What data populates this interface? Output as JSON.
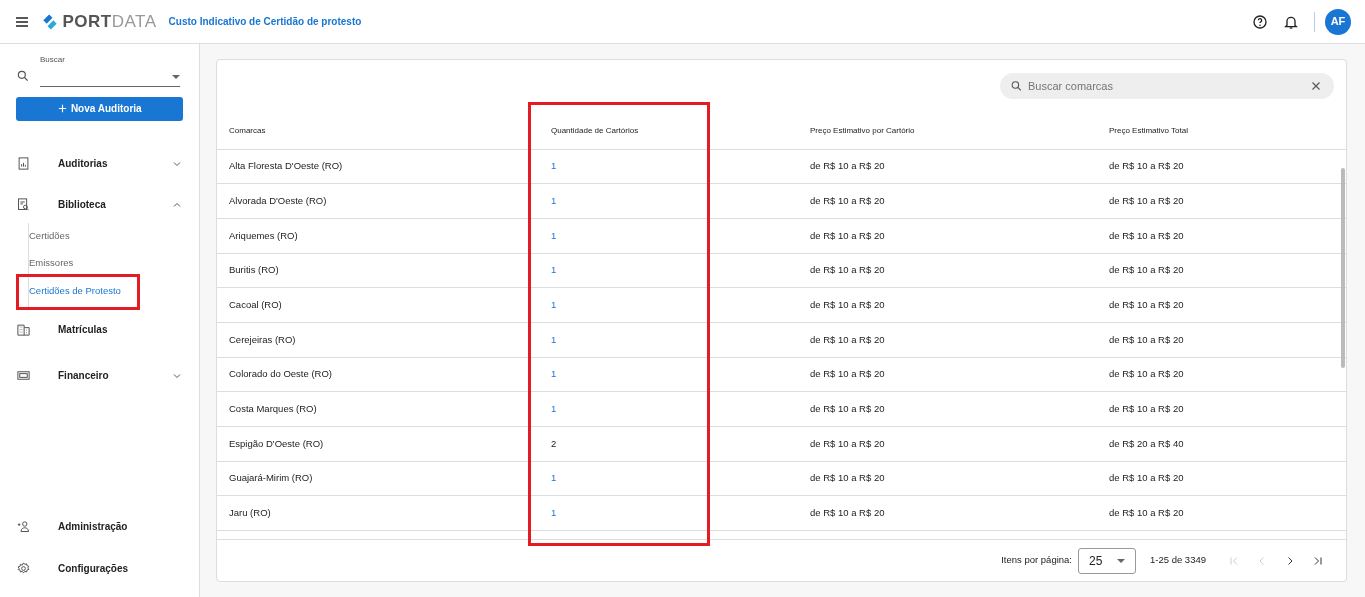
{
  "header": {
    "brand_bold": "PORT",
    "brand_light": "DATA",
    "page_title": "Custo Indicativo de Certidão de protesto",
    "avatar": "AF"
  },
  "sidebar": {
    "search": {
      "label": "Buscar"
    },
    "new_button": "Nova Auditoria",
    "items": [
      {
        "label": "Auditorias",
        "expanded": false
      },
      {
        "label": "Biblioteca",
        "expanded": true,
        "children": [
          {
            "label": "Certidões",
            "selected": false,
            "highlighted": false
          },
          {
            "label": "Emissores",
            "selected": false,
            "highlighted": false
          },
          {
            "label": "Certidões de Protesto",
            "selected": true,
            "highlighted": true
          }
        ]
      },
      {
        "label": "Matrículas"
      },
      {
        "label": "Financeiro",
        "expanded": false
      }
    ],
    "bottom_items": [
      {
        "label": "Administração"
      },
      {
        "label": "Configurações"
      }
    ]
  },
  "search": {
    "placeholder": "Buscar comarcas"
  },
  "table": {
    "columns": [
      {
        "label": "Comarcas",
        "highlighted": false
      },
      {
        "label": "Quantidade de Cartórios",
        "highlighted": true
      },
      {
        "label": "Preço Estimativo por Cartório",
        "highlighted": false
      },
      {
        "label": "Preço Estimativo Total",
        "highlighted": false
      }
    ],
    "rows": [
      {
        "comarca": "Alta Floresta D'Oeste (RO)",
        "quantidade": "1",
        "linked": true,
        "preco": "de R$ 10 a R$ 20",
        "total": "de R$ 10 a R$ 20"
      },
      {
        "comarca": "Alvorada D'Oeste (RO)",
        "quantidade": "1",
        "linked": true,
        "preco": "de R$ 10 a R$ 20",
        "total": "de R$ 10 a R$ 20"
      },
      {
        "comarca": "Ariquemes (RO)",
        "quantidade": "1",
        "linked": true,
        "preco": "de R$ 10 a R$ 20",
        "total": "de R$ 10 a R$ 20"
      },
      {
        "comarca": "Buritis (RO)",
        "quantidade": "1",
        "linked": true,
        "preco": "de R$ 10 a R$ 20",
        "total": "de R$ 10 a R$ 20"
      },
      {
        "comarca": "Cacoal (RO)",
        "quantidade": "1",
        "linked": true,
        "preco": "de R$ 10 a R$ 20",
        "total": "de R$ 10 a R$ 20"
      },
      {
        "comarca": "Cerejeiras (RO)",
        "quantidade": "1",
        "linked": true,
        "preco": "de R$ 10 a R$ 20",
        "total": "de R$ 10 a R$ 20"
      },
      {
        "comarca": "Colorado do Oeste (RO)",
        "quantidade": "1",
        "linked": true,
        "preco": "de R$ 10 a R$ 20",
        "total": "de R$ 10 a R$ 20"
      },
      {
        "comarca": "Costa Marques (RO)",
        "quantidade": "1",
        "linked": true,
        "preco": "de R$ 10 a R$ 20",
        "total": "de R$ 10 a R$ 20"
      },
      {
        "comarca": "Espigão D'Oeste (RO)",
        "quantidade": "2",
        "linked": false,
        "preco": "de R$ 10 a R$ 20",
        "total": "de R$ 20 a R$ 40"
      },
      {
        "comarca": "Guajará-Mirim (RO)",
        "quantidade": "1",
        "linked": true,
        "preco": "de R$ 10 a R$ 20",
        "total": "de R$ 10 a R$ 20"
      },
      {
        "comarca": "Jaru (RO)",
        "quantidade": "1",
        "linked": true,
        "preco": "de R$ 10 a R$ 20",
        "total": "de R$ 10 a R$ 20"
      }
    ]
  },
  "paginator": {
    "label": "Itens por página:",
    "page_size": "25",
    "range": "1-25 de 3349",
    "first_disabled": true,
    "previous_disabled": true,
    "next_disabled": false,
    "last_disabled": false
  }
}
